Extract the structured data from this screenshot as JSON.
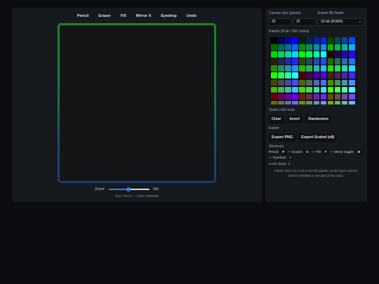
{
  "toolbar": {
    "items": [
      {
        "label": "Pencil",
        "name": "tool-pencil"
      },
      {
        "label": "Eraser",
        "name": "tool-eraser"
      },
      {
        "label": "Fill",
        "name": "tool-fill"
      },
      {
        "label": "Mirror X",
        "name": "tool-mirror-x"
      },
      {
        "label": "Eyedrop",
        "name": "tool-eyedrop"
      },
      {
        "label": "Undo",
        "name": "tool-undo"
      }
    ]
  },
  "zoom": {
    "label": "Zoom:",
    "value": 16,
    "min": 1,
    "max": 32,
    "display": "16x"
  },
  "status": {
    "text": "Tool: Pencil — Color: #000000"
  },
  "settings": {
    "canvas_size_label": "Canvas Size (pixels)",
    "width": "32",
    "height": "32",
    "bit_depth_label": "Export Bit Depth",
    "bit_depth_value": "32-bit (RGBA)",
    "palette_label": "Palette (8-bit / 256 colors)"
  },
  "palette": {
    "colors": [
      "#000000",
      "#000055",
      "#0000aa",
      "#0000ff",
      "#002400",
      "#002455",
      "#0024aa",
      "#0024ff",
      "#004900",
      "#004955",
      "#0049aa",
      "#0049ff",
      "#006d00",
      "#006d55",
      "#006daa",
      "#006dff",
      "#009200",
      "#009255",
      "#0092aa",
      "#0092ff",
      "#00b600",
      "#00b655",
      "#00b6aa",
      "#00b6ff",
      "#00db00",
      "#00db55",
      "#00dbaa",
      "#00dbff",
      "#00ff00",
      "#00ff55",
      "#00ffaa",
      "#00ffff",
      "#240000",
      "#240055",
      "#2400aa",
      "#2400ff",
      "#242400",
      "#242455",
      "#2424aa",
      "#2424ff",
      "#244900",
      "#244955",
      "#2449aa",
      "#2449ff",
      "#246d00",
      "#246d55",
      "#246daa",
      "#246dff",
      "#249200",
      "#249255",
      "#2492aa",
      "#2492ff",
      "#24b600",
      "#24b655",
      "#24b6aa",
      "#24b6ff",
      "#24db00",
      "#24db55",
      "#24dbaa",
      "#24dbff",
      "#24ff00",
      "#24ff55",
      "#24ffaa",
      "#24ffff",
      "#490000",
      "#490055",
      "#4900aa",
      "#4900ff",
      "#492400",
      "#492455",
      "#4924aa",
      "#4924ff",
      "#494900",
      "#494955",
      "#4949aa",
      "#4949ff",
      "#496d00",
      "#496d55",
      "#496daa",
      "#496dff",
      "#499200",
      "#499255",
      "#4992aa",
      "#4992ff",
      "#49b600",
      "#49b655",
      "#49b6aa",
      "#49b6ff",
      "#49db00",
      "#49db55",
      "#49dbaa",
      "#49dbff",
      "#49ff00",
      "#49ff55",
      "#49ffaa",
      "#49ffff",
      "#6d0000",
      "#6d0055",
      "#6d00aa",
      "#6d00ff",
      "#6d2400",
      "#6d2455",
      "#6d24aa",
      "#6d24ff",
      "#6d4900",
      "#6d4955",
      "#6d49aa",
      "#6d49ff",
      "#6d6d00",
      "#6d6d55",
      "#6d6daa",
      "#6d6dff",
      "#6d9200",
      "#6d9255",
      "#6d92aa",
      "#6d92ff",
      "#6db600",
      "#6db655",
      "#6db6aa",
      "#6db6ff"
    ]
  },
  "quick_tools": {
    "label": "Quick color tools",
    "buttons": [
      {
        "label": "Clear",
        "name": "clear-button"
      },
      {
        "label": "Invert",
        "name": "invert-button"
      },
      {
        "label": "Randomize",
        "name": "randomize-button"
      }
    ]
  },
  "export": {
    "label": "Export",
    "buttons": [
      {
        "label": "Export PNG",
        "name": "export-png-button"
      },
      {
        "label": "Export Scaled (x8)",
        "name": "export-scaled-button"
      }
    ]
  },
  "shortcuts": {
    "label": "Shortcuts",
    "pencil": "Pencil:",
    "pencil_key": "P",
    "eraser": "— Eraser:",
    "eraser_key": "E",
    "fill": "— Fill:",
    "fill_key": "F",
    "mirror": "— Mirror toggle:",
    "mirror_key": "M",
    "eyedrop": "— Eyedrop:",
    "eyedrop_key": "I"
  },
  "undo_depth": "Undo depth: 3",
  "note": "Palette uses a 3-3-2 (R-G-B) 8-bit palette. 16-bit export reduces colors to RGB565 to simulate 16-bit output.",
  "colors": {
    "accent": "#2f7ee0",
    "panel": "#16191e",
    "background": "#0b0d10",
    "canvas_border_top": "#15891d",
    "canvas_border_bottom": "#1c3a73"
  }
}
